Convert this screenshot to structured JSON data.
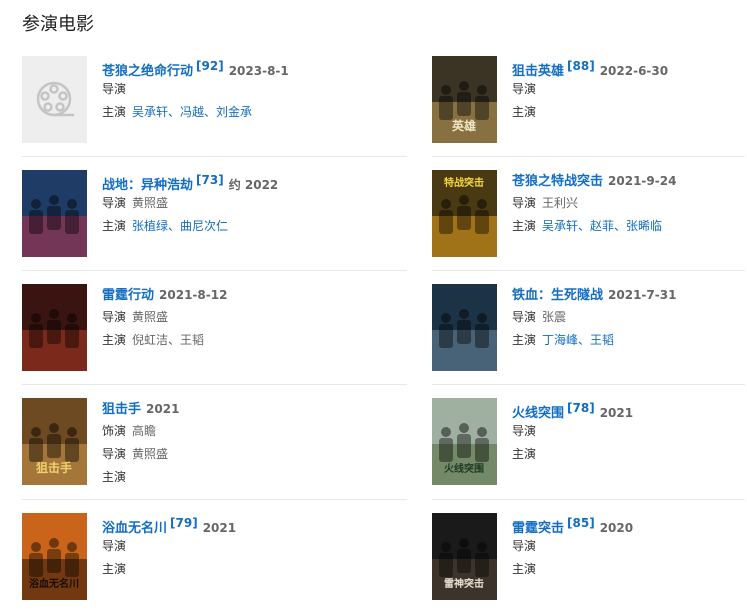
{
  "section": {
    "title": "参演电影"
  },
  "films": [
    {
      "title": "苍狼之绝命行动",
      "score": "[92]",
      "date": "2023-8-1",
      "rows": [
        {
          "label": "导演",
          "value": ""
        },
        {
          "label": "主演",
          "value": "吴承轩、冯越、刘金承",
          "link": true
        }
      ],
      "poster": {
        "kind": "placeholder",
        "icon": "film-reel-icon"
      }
    },
    {
      "title": "狙击英雄",
      "score": "[88]",
      "date": "2022-6-30",
      "rows": [
        {
          "label": "导演",
          "value": ""
        },
        {
          "label": "主演",
          "value": ""
        }
      ],
      "poster": {
        "kind": "image",
        "bg": "#3b3324",
        "accent": "#c9a25a",
        "text": "英雄",
        "textColor": "#f2e6c4"
      }
    },
    {
      "title": "战地：异种浩劫",
      "score": "[73]",
      "date": "约 2022",
      "rows": [
        {
          "label": "导演",
          "value": "黄照盛",
          "link": false
        },
        {
          "label": "主演",
          "value": "张植绿、曲尼次仁",
          "link": true
        }
      ],
      "poster": {
        "kind": "image",
        "bg": "#1f3c66",
        "accent": "#b8324a",
        "text": "",
        "textColor": "#ffffff"
      }
    },
    {
      "title": "苍狼之特战突击",
      "score": "",
      "date": "2021-9-24",
      "rows": [
        {
          "label": "导演",
          "value": "王利兴",
          "link": false
        },
        {
          "label": "主演",
          "value": "吴承轩、赵菲、张晞临",
          "link": true
        }
      ],
      "poster": {
        "kind": "image",
        "bg": "#4a3a14",
        "accent": "#e8a21b",
        "text": "特战突击",
        "textColor": "#f5d63a"
      }
    },
    {
      "title": "雷霆行动",
      "score": "",
      "date": "2021-8-12",
      "rows": [
        {
          "label": "导演",
          "value": "黄照盛",
          "link": false
        },
        {
          "label": "主演",
          "value": "倪虹洁、王韬",
          "link": false
        }
      ],
      "poster": {
        "kind": "image",
        "bg": "#3a1410",
        "accent": "#b03a22",
        "text": "",
        "textColor": "#ffffff"
      }
    },
    {
      "title": "铁血：生死隧战",
      "score": "",
      "date": "2021-7-31",
      "rows": [
        {
          "label": "导演",
          "value": "张震",
          "link": false
        },
        {
          "label": "主演",
          "value": "丁海峰、王韬",
          "link": true
        }
      ],
      "poster": {
        "kind": "image",
        "bg": "#1c3346",
        "accent": "#6d8aa3",
        "text": "",
        "textColor": "#ffffff"
      }
    },
    {
      "title": "狙击手",
      "score": "",
      "date": "2021",
      "rows": [
        {
          "label": "饰演",
          "value": "高瞻",
          "link": false
        },
        {
          "label": "导演",
          "value": "黄照盛",
          "link": false
        },
        {
          "label": "主演",
          "value": ""
        }
      ],
      "poster": {
        "kind": "image",
        "bg": "#6e4a22",
        "accent": "#d29a4c",
        "text": "狙击手",
        "textColor": "#f0d070"
      }
    },
    {
      "title": "火线突围",
      "score": "[78]",
      "date": "2021",
      "rows": [
        {
          "label": "导演",
          "value": ""
        },
        {
          "label": "主演",
          "value": ""
        }
      ],
      "poster": {
        "kind": "image",
        "bg": "#9fb0a0",
        "accent": "#4f6a3a",
        "text": "火线突围",
        "textColor": "#1e3b22"
      }
    },
    {
      "title": "浴血无名川",
      "score": "[79]",
      "date": "2021",
      "rows": [
        {
          "label": "导演",
          "value": ""
        },
        {
          "label": "主演",
          "value": ""
        }
      ],
      "poster": {
        "kind": "image",
        "bg": "#c9641a",
        "accent": "#2a1408",
        "text": "浴血无名川",
        "textColor": "#1a0d05"
      }
    },
    {
      "title": "雷霆突击",
      "score": "[85]",
      "date": "2020",
      "rows": [
        {
          "label": "导演",
          "value": ""
        },
        {
          "label": "主演",
          "value": ""
        }
      ],
      "poster": {
        "kind": "image",
        "bg": "#1a1a1a",
        "accent": "#5a4a3a",
        "text": "雷神突击",
        "textColor": "#e8e0d0"
      }
    }
  ]
}
